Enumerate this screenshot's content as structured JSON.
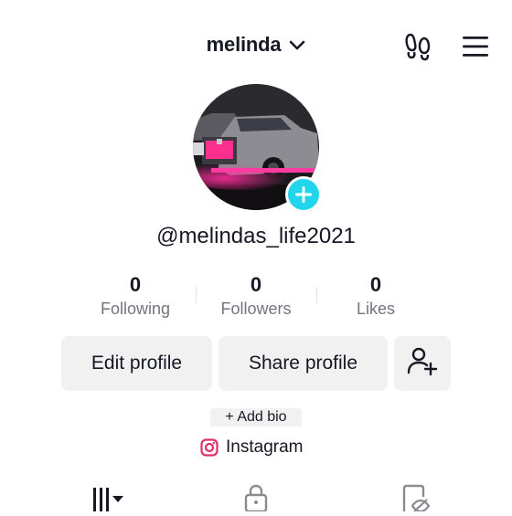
{
  "header": {
    "username": "melinda",
    "icons": {
      "dropdown": "chevron-down-icon",
      "footprints": "footprints-icon",
      "menu": "hamburger-menu-icon"
    }
  },
  "profile": {
    "handle": "@melindas_life2021",
    "avatar_icon": "avatar-photo-pickup-truck",
    "add_icon": "plus-icon",
    "accent": "#20d5ec"
  },
  "stats": [
    {
      "value": "0",
      "label": "Following"
    },
    {
      "value": "0",
      "label": "Followers"
    },
    {
      "value": "0",
      "label": "Likes"
    }
  ],
  "actions": {
    "edit_profile": "Edit profile",
    "share_profile": "Share profile",
    "add_friend_icon": "add-user-icon"
  },
  "bio": {
    "add_bio": "+ Add bio",
    "link_label": "Instagram",
    "link_icon": "instagram-icon"
  },
  "tabs": [
    {
      "name": "videos",
      "icon": "grid-bars-icon"
    },
    {
      "name": "private",
      "icon": "lock-icon"
    },
    {
      "name": "liked",
      "icon": "hidden-bookmark-icon"
    }
  ]
}
